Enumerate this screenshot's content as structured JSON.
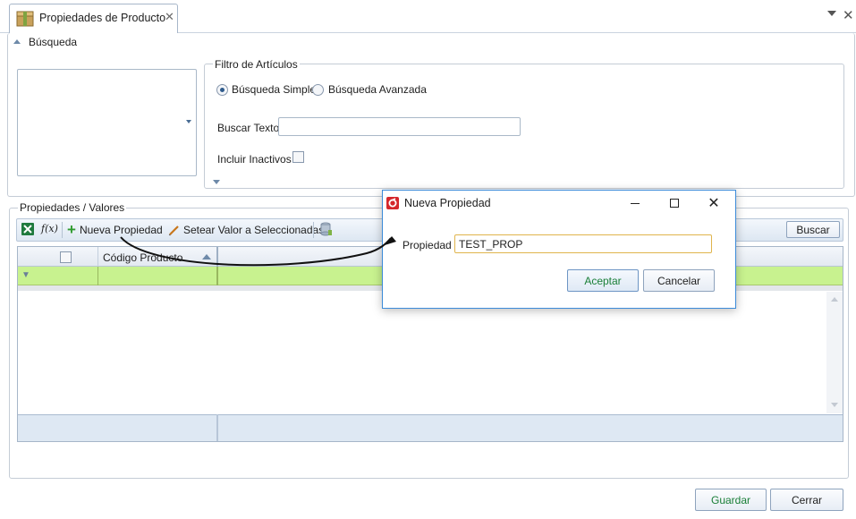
{
  "tab": {
    "title": "Propiedades de Producto",
    "close_glyph": "✕"
  },
  "search_section": {
    "title": "Búsqueda",
    "filter": {
      "title": "Filtro de Artículos",
      "radio_simple": "Búsqueda Simple",
      "radio_advanced": "Búsqueda Avanzada",
      "selected": "simple",
      "search_text_label": "Buscar Texto",
      "search_text_value": "",
      "include_inactive_label": "Incluir Inactivos",
      "include_inactive_checked": false
    }
  },
  "props_section": {
    "title": "Propiedades / Valores",
    "toolbar": {
      "new_property": "Nueva Propiedad",
      "set_value": "Setear Valor a Seleccionadas",
      "search": "Buscar"
    },
    "grid": {
      "columns": [
        "Código Producto"
      ],
      "rows": []
    }
  },
  "footer": {
    "save": "Guardar",
    "close": "Cerrar"
  },
  "dialog": {
    "title": "Nueva Propiedad",
    "property_label": "Propiedad",
    "property_value": "TEST_PROP",
    "accept": "Aceptar",
    "cancel": "Cancelar"
  },
  "colors": {
    "filter_row": "#c8f28f",
    "accept_text": "#1a7f37",
    "dialog_border": "#3c8bd9",
    "grid_footer": "#dee8f3"
  }
}
